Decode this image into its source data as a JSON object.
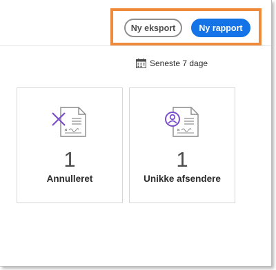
{
  "toolbar": {
    "export_label": "Ny eksport",
    "report_label": "Ny rapport",
    "highlight_color": "#ef8a3b",
    "primary_color": "#1473e6"
  },
  "date_filter": {
    "icon": "calendar-icon",
    "label": "Seneste 7 dage"
  },
  "cards": [
    {
      "icon": "cancelled-document-icon",
      "count": "1",
      "label": "Annulleret",
      "accent_color": "#7b4fc9"
    },
    {
      "icon": "unique-sender-document-icon",
      "count": "1",
      "label": "Unikke afsendere",
      "accent_color": "#7b4fc9"
    }
  ]
}
